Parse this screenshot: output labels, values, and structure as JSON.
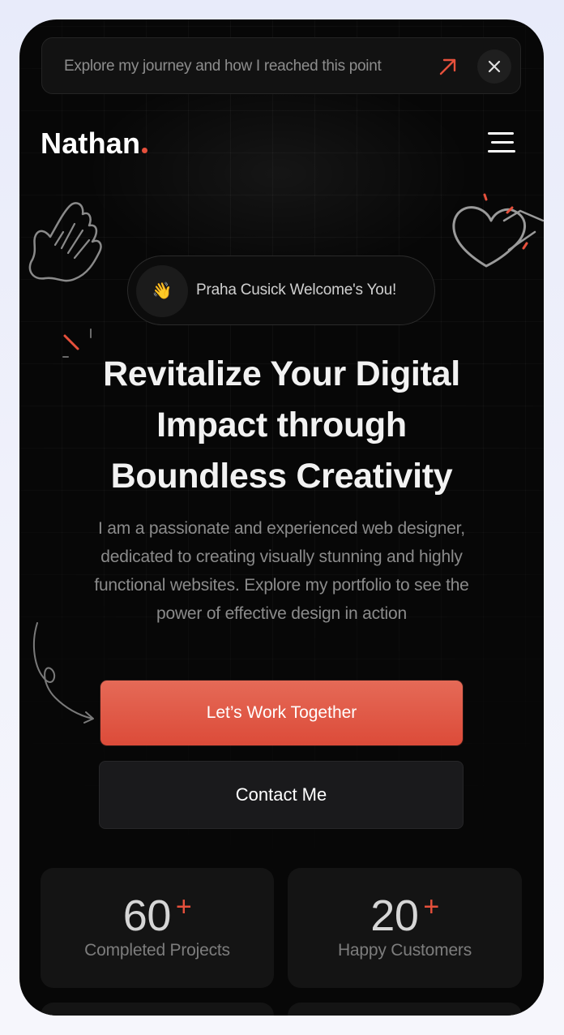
{
  "announcement": {
    "text": "Explore my journey and how I reached this point",
    "arrow_icon": "arrow-up-right-icon",
    "close_icon": "close-icon"
  },
  "header": {
    "logo_text": "Nathan",
    "menu_icon": "hamburger-menu-icon"
  },
  "welcome": {
    "emoji": "👋",
    "text": "Praha Cusick Welcome's You!"
  },
  "hero": {
    "title_lines": [
      "Revitalize Your Digital",
      "Impact through",
      "Boundless Creativity"
    ],
    "description_lines": [
      "I am a passionate and experienced web designer,",
      "dedicated to creating visually stunning and highly",
      "functional websites. Explore my portfolio to see the",
      "power of effective design in action"
    ]
  },
  "buttons": {
    "primary_label": "Let’s Work Together",
    "secondary_label": "Contact Me"
  },
  "stats": [
    {
      "value": "60",
      "suffix": "+",
      "label": "Completed Projects"
    },
    {
      "value": "20",
      "suffix": "+",
      "label": "Happy Customers"
    }
  ],
  "colors": {
    "accent": "#e6503c",
    "background": "#070707",
    "card": "#141414",
    "frame": "#eef0fb"
  }
}
